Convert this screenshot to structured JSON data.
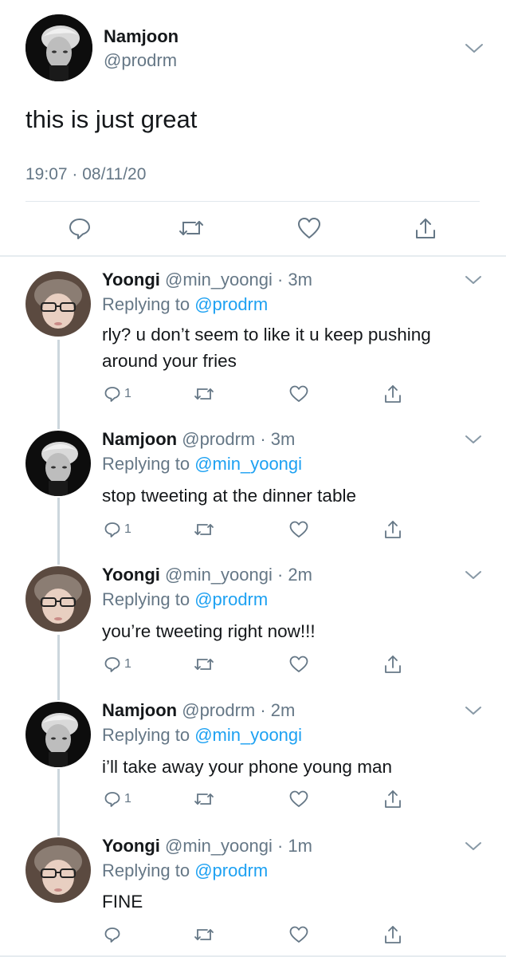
{
  "main": {
    "name": "Namjoon",
    "handle": "@prodrm",
    "text": "this is just great",
    "timestamp": "19:07 · 08/11/20",
    "actions": [
      "reply-icon",
      "retweet-icon",
      "like-icon",
      "share-icon"
    ]
  },
  "replies": [
    {
      "name": "Yoongi",
      "meta": " @min_yoongi · 3m",
      "replying_prefix": "Replying to ",
      "replying_to": "@prodrm",
      "text": "rly? u don’t seem to like it u keep pushing around your fries",
      "reply_count": "1",
      "avatar": "yoongi"
    },
    {
      "name": "Namjoon",
      "meta": " @prodrm · 3m",
      "replying_prefix": "Replying to ",
      "replying_to": "@min_yoongi",
      "text": "stop tweeting at the dinner table",
      "reply_count": "1",
      "avatar": "namjoon"
    },
    {
      "name": "Yoongi",
      "meta": " @min_yoongi · 2m",
      "replying_prefix": "Replying to ",
      "replying_to": "@prodrm",
      "text": "you’re tweeting right now!!!",
      "reply_count": "1",
      "avatar": "yoongi"
    },
    {
      "name": "Namjoon",
      "meta": " @prodrm · 2m",
      "replying_prefix": "Replying to ",
      "replying_to": "@min_yoongi",
      "text": "i’ll take away your phone young man",
      "reply_count": "1",
      "avatar": "namjoon"
    },
    {
      "name": "Yoongi",
      "meta": " @min_yoongi · 1m",
      "replying_prefix": "Replying to ",
      "replying_to": "@prodrm",
      "text": "FINE",
      "reply_count": "",
      "avatar": "yoongi"
    }
  ],
  "colors": {
    "text": "#14171a",
    "muted": "#657786",
    "link": "#1da1f2",
    "divider": "#e1e8ed",
    "thread_line": "#ccd6dd"
  }
}
